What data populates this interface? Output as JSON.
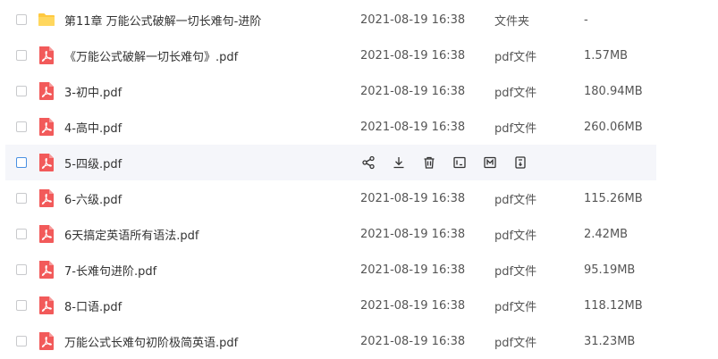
{
  "files": [
    {
      "name": "第11章 万能公式破解一切长难句-进阶",
      "date": "2021-08-19 16:38",
      "type": "文件夹",
      "size": "-",
      "kind": "folder-icon"
    },
    {
      "name": "《万能公式破解一切长难句》.pdf",
      "date": "2021-08-19 16:38",
      "type": "pdf文件",
      "size": "1.57MB",
      "kind": "pdf-icon"
    },
    {
      "name": "3-初中.pdf",
      "date": "2021-08-19 16:38",
      "type": "pdf文件",
      "size": "180.94MB",
      "kind": "pdf-icon"
    },
    {
      "name": "4-高中.pdf",
      "date": "2021-08-19 16:38",
      "type": "pdf文件",
      "size": "260.06MB",
      "kind": "pdf-icon"
    },
    {
      "name": "5-四级.pdf",
      "date": "",
      "type": "",
      "size": "",
      "kind": "pdf-icon",
      "hovered": true
    },
    {
      "name": "6-六级.pdf",
      "date": "2021-08-19 16:38",
      "type": "pdf文件",
      "size": "115.26MB",
      "kind": "pdf-icon"
    },
    {
      "name": "6天搞定英语所有语法.pdf",
      "date": "2021-08-19 16:38",
      "type": "pdf文件",
      "size": "2.42MB",
      "kind": "pdf-icon"
    },
    {
      "name": "7-长难句进阶.pdf",
      "date": "2021-08-19 16:38",
      "type": "pdf文件",
      "size": "95.19MB",
      "kind": "pdf-icon"
    },
    {
      "name": "8-口语.pdf",
      "date": "2021-08-19 16:38",
      "type": "pdf文件",
      "size": "118.12MB",
      "kind": "pdf-icon"
    },
    {
      "name": "万能公式长难句初阶极简英语.pdf",
      "date": "2021-08-19 16:38",
      "type": "pdf文件",
      "size": "31.23MB",
      "kind": "pdf-icon"
    }
  ],
  "hover_actions": [
    "share-icon",
    "download-icon",
    "delete-icon",
    "rename-icon",
    "move-icon",
    "more-icon"
  ],
  "colors": {
    "pdf": "#f25a5a",
    "folder": "#ffc940",
    "hover_bg": "#f5f6fa",
    "checkbox_active": "#4a90e2"
  }
}
